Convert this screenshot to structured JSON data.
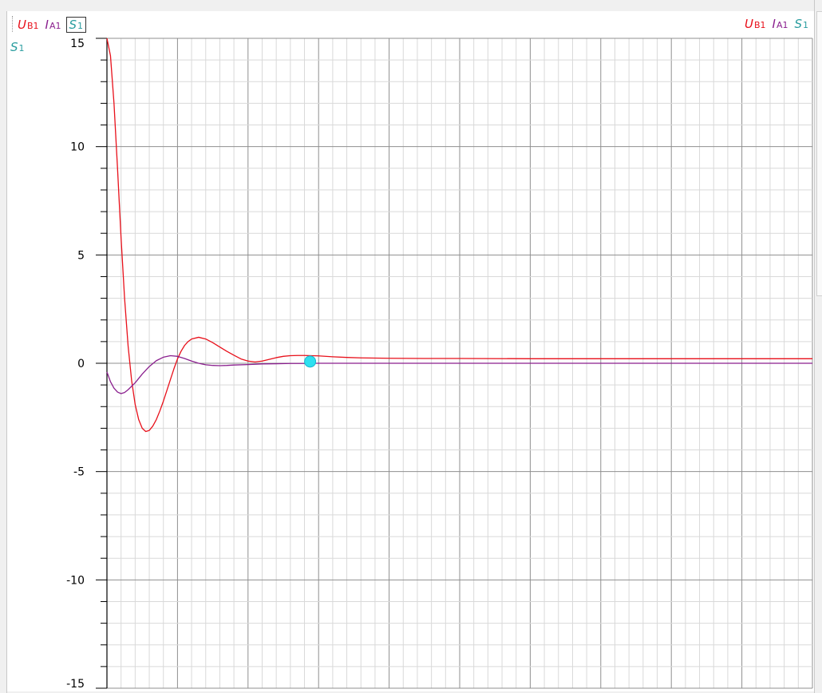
{
  "series_labels": {
    "u_b1": {
      "main": "U",
      "sub": "B1",
      "color": "#e8101a"
    },
    "i_a1": {
      "main": "I",
      "sub": "A1",
      "color": "#8a1f8e"
    },
    "s_1": {
      "main": "S",
      "sub": "1",
      "color": "#2a9d9f"
    }
  },
  "axis_unit": {
    "main": "S",
    "sub": "1",
    "color": "#2a9d9f"
  },
  "cursor_color": "#2ee0f0",
  "chart_data": {
    "type": "line",
    "ylim": [
      -15,
      15
    ],
    "xlim": [
      0,
      10
    ],
    "ytick_labels": [
      "15",
      "10",
      "5",
      "0",
      "-5",
      "-10",
      "-15"
    ],
    "ytick_values": [
      15,
      10,
      5,
      0,
      -5,
      -10,
      -15
    ],
    "grid": true,
    "series": [
      {
        "key": "u_b1",
        "color": "#e8101a",
        "x": [
          0,
          0.05,
          0.1,
          0.15,
          0.2,
          0.25,
          0.3,
          0.35,
          0.4,
          0.45,
          0.5,
          0.55,
          0.6,
          0.65,
          0.7,
          0.75,
          0.8,
          0.85,
          0.9,
          0.95,
          1.0,
          1.05,
          1.1,
          1.15,
          1.2,
          1.3,
          1.4,
          1.5,
          1.6,
          1.7,
          1.8,
          1.9,
          2.0,
          2.1,
          2.2,
          2.3,
          2.4,
          2.5,
          2.6,
          2.7,
          2.8,
          2.9,
          3.0,
          3.2,
          3.4,
          3.6,
          3.8,
          4.0,
          4.5,
          5.0,
          6.0,
          7.0,
          8.0,
          9.0,
          10.0
        ],
        "y": [
          15.0,
          14.2,
          12.0,
          9.0,
          5.8,
          3.0,
          0.8,
          -0.8,
          -1.9,
          -2.6,
          -3.0,
          -3.15,
          -3.1,
          -2.9,
          -2.6,
          -2.2,
          -1.75,
          -1.25,
          -0.75,
          -0.25,
          0.2,
          0.55,
          0.82,
          1.0,
          1.12,
          1.2,
          1.12,
          0.95,
          0.75,
          0.55,
          0.37,
          0.2,
          0.1,
          0.06,
          0.1,
          0.18,
          0.26,
          0.32,
          0.35,
          0.36,
          0.36,
          0.35,
          0.34,
          0.3,
          0.27,
          0.25,
          0.24,
          0.23,
          0.22,
          0.22,
          0.21,
          0.21,
          0.21,
          0.21,
          0.21
        ]
      },
      {
        "key": "i_a1",
        "color": "#8a1f8e",
        "x": [
          0,
          0.05,
          0.1,
          0.15,
          0.2,
          0.25,
          0.3,
          0.4,
          0.5,
          0.6,
          0.7,
          0.8,
          0.9,
          1.0,
          1.1,
          1.2,
          1.3,
          1.4,
          1.5,
          1.6,
          1.7,
          1.8,
          2.0,
          2.2,
          2.4,
          2.6,
          2.8,
          3.0,
          3.5,
          4.0,
          5.0,
          6.0,
          7.0,
          8.0,
          9.0,
          10.0
        ],
        "y": [
          -0.4,
          -0.85,
          -1.15,
          -1.33,
          -1.4,
          -1.35,
          -1.22,
          -0.9,
          -0.5,
          -0.15,
          0.12,
          0.28,
          0.35,
          0.32,
          0.22,
          0.1,
          0.0,
          -0.07,
          -0.1,
          -0.11,
          -0.1,
          -0.08,
          -0.06,
          -0.03,
          -0.02,
          -0.01,
          -0.01,
          0.0,
          0.0,
          0.0,
          0.0,
          0.0,
          0.0,
          0.0,
          0.0,
          0.0
        ]
      }
    ],
    "cursor": {
      "x": 2.88,
      "y": 0.08
    }
  }
}
